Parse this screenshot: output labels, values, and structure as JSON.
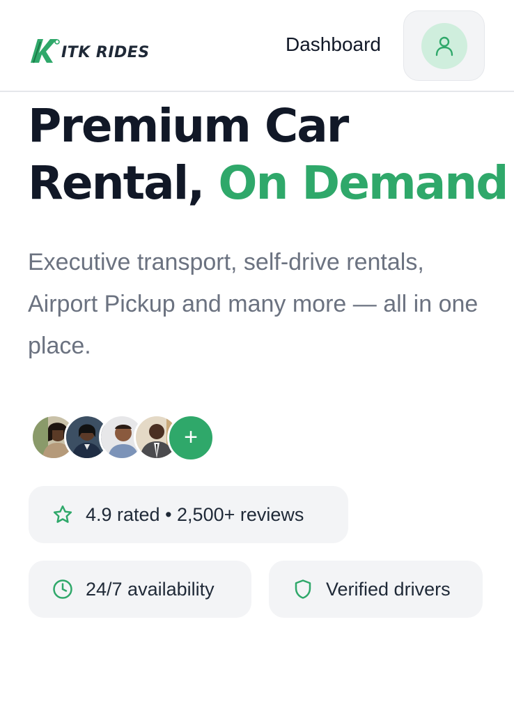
{
  "brand": {
    "name": "ITK RIDES",
    "accent_color": "#2fa86a"
  },
  "nav": {
    "dashboard_label": "Dashboard",
    "profile_icon": "user-icon"
  },
  "hero": {
    "title_line1": "Premium Car",
    "title_line2_plain": "Rental,",
    "title_line2_accent": "On Demand",
    "subtitle": "Executive transport, self-drive rentals, Airport Pickup and many more — all in one place."
  },
  "customers": {
    "avatar_count": 4,
    "more_label": "+"
  },
  "badges": {
    "rating": {
      "icon": "star-icon",
      "text": "4.9 rated • 2,500+ reviews"
    },
    "availability": {
      "icon": "clock-icon",
      "text": "24/7 availability"
    },
    "verified": {
      "icon": "shield-icon",
      "text": "Verified drivers"
    }
  }
}
